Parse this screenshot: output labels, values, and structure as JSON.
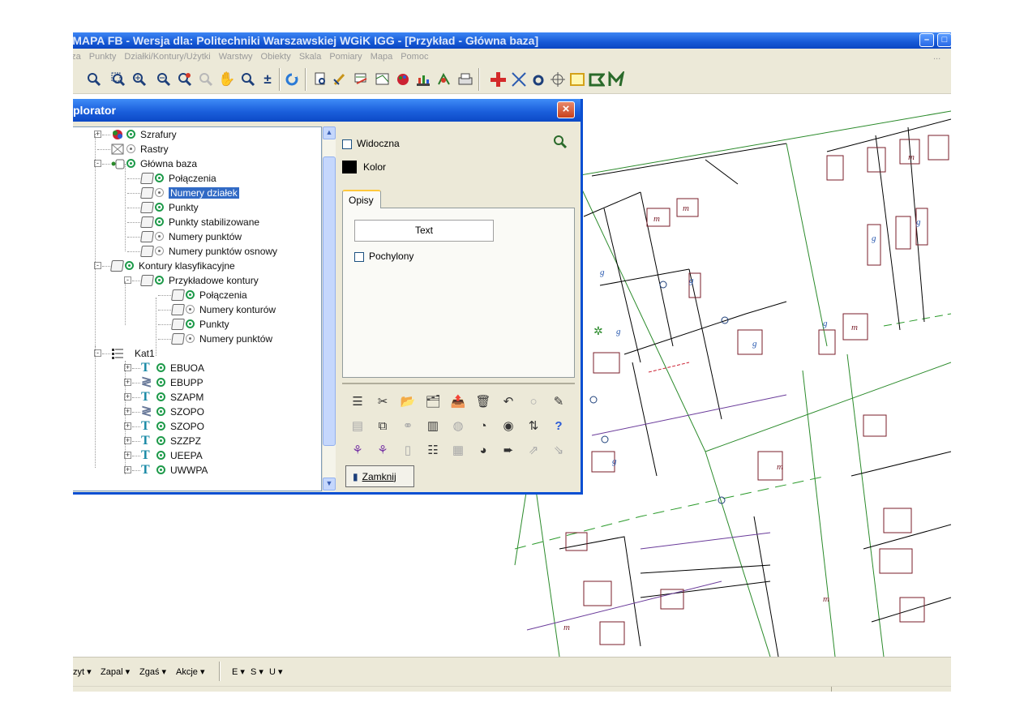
{
  "window": {
    "title": "WMAPA FB - Wersja dla: Politechniki Warszawskiej WGiK IGG - [Przykład - Główna baza]",
    "minimize": "–",
    "restore": "□"
  },
  "menu": [
    "aza",
    "Punkty",
    "Działki/Kontury/Użytki",
    "Warstwy",
    "Obiekty",
    "Skala",
    "Pomiary",
    "Mapa",
    "Pomoc"
  ],
  "menu_right": "...",
  "toolbar": {
    "icons": [
      "zoom-icon",
      "zoom-window-icon",
      "zoom-in-icon",
      "zoom-out-icon",
      "zoom-previous-icon",
      "zoom-disabled-icon",
      "pan-hand-icon",
      "zoom-all-icon",
      "zoom-plusminus-icon",
      "refresh-icon",
      "print-preview-icon",
      "edit-pen-icon",
      "layers-icon",
      "map-icon",
      "palette-icon",
      "chart-icon",
      "measure-icon",
      "print-icon",
      "add-cross-icon",
      "delete-x-icon",
      "point-circle-icon",
      "target-icon",
      "rectangle-icon",
      "polygon-icon",
      "polyline-icon"
    ]
  },
  "explorer": {
    "title": "plorator",
    "close": "×",
    "tree": [
      {
        "label": "Szrafury",
        "level": 0,
        "icon": "hatching-icon",
        "vis": "on",
        "expander": "+"
      },
      {
        "label": "Rastry",
        "level": 0,
        "icon": "raster-icon",
        "vis": "off",
        "expander": ""
      },
      {
        "label": "Główna baza",
        "level": 0,
        "icon": "database-icon",
        "vis": "on",
        "expander": "-"
      },
      {
        "label": "Połączenia",
        "level": 1,
        "icon": "layer-icon",
        "vis": "on",
        "expander": ""
      },
      {
        "label": "Numery działek",
        "level": 1,
        "icon": "layer-icon",
        "vis": "off",
        "expander": "",
        "selected": true
      },
      {
        "label": "Punkty",
        "level": 1,
        "icon": "layer-icon",
        "vis": "on",
        "expander": ""
      },
      {
        "label": "Punkty stabilizowane",
        "level": 1,
        "icon": "layer-icon",
        "vis": "on",
        "expander": ""
      },
      {
        "label": "Numery punktów",
        "level": 1,
        "icon": "layer-icon",
        "vis": "off",
        "expander": ""
      },
      {
        "label": "Numery punktów osnowy",
        "level": 1,
        "icon": "layer-icon",
        "vis": "off",
        "expander": ""
      },
      {
        "label": "Kontury klasyfikacyjne",
        "level": 0,
        "icon": "layer-icon",
        "vis": "on",
        "expander": "-"
      },
      {
        "label": "Przykładowe kontury",
        "level": 1,
        "icon": "layer-icon",
        "vis": "on",
        "expander": "-"
      },
      {
        "label": "Połączenia",
        "level": 2,
        "icon": "layer-icon",
        "vis": "on",
        "expander": ""
      },
      {
        "label": "Numery konturów",
        "level": 2,
        "icon": "layer-icon",
        "vis": "off",
        "expander": ""
      },
      {
        "label": "Punkty",
        "level": 2,
        "icon": "layer-icon",
        "vis": "on",
        "expander": ""
      },
      {
        "label": "Numery punktów",
        "level": 2,
        "icon": "layer-icon",
        "vis": "off",
        "expander": ""
      },
      {
        "label": "Kat1",
        "level": 0,
        "icon": "category-icon",
        "vis": "none",
        "expander": "-"
      },
      {
        "label": "EBUOA",
        "level": 1,
        "icon": "text-layer-icon",
        "vis": "on",
        "expander": "+"
      },
      {
        "label": "EBUPP",
        "level": 1,
        "icon": "symbol-layer-icon",
        "vis": "on",
        "expander": "+"
      },
      {
        "label": "SZAPM",
        "level": 1,
        "icon": "text-layer-icon",
        "vis": "on",
        "expander": "+"
      },
      {
        "label": "SZOPO",
        "level": 1,
        "icon": "symbol-layer-icon",
        "vis": "on",
        "expander": "+"
      },
      {
        "label": "SZOPO",
        "level": 1,
        "icon": "text-layer-icon",
        "vis": "on",
        "expander": "+"
      },
      {
        "label": "SZZPZ",
        "level": 1,
        "icon": "text-layer-icon",
        "vis": "on",
        "expander": "+"
      },
      {
        "label": "UEEPA",
        "level": 1,
        "icon": "text-layer-icon",
        "vis": "on",
        "expander": "+"
      },
      {
        "label": "UWWPA",
        "level": 1,
        "icon": "text-layer-icon",
        "vis": "on",
        "expander": "+"
      }
    ],
    "props": {
      "visible_label": "Widoczna",
      "visible_checked": false,
      "color_label": "Kolor",
      "color_value": "#000000",
      "tab_label": "Opisy",
      "text_button": "Text",
      "italic_label": "Pochylony",
      "italic_checked": false,
      "close_button": "Zamknij"
    },
    "action_icons": [
      "new-category-icon",
      "cut-icon",
      "open-folder-icon",
      "open-folder-multi-icon",
      "folder-export-icon",
      "trash-icon",
      "undo-icon",
      "circle-disabled-icon",
      "pen-icon",
      "calendar-disabled-icon",
      "copy-layer-icon",
      "link-disabled-icon",
      "book-icon",
      "stamp-disabled-icon",
      "pie-chart-icon",
      "eye-icon",
      "sort-az-icon",
      "help-icon",
      "tree-branch-icon",
      "tree-branch-2-icon",
      "trash-disabled-icon",
      "list-icon",
      "calculator-disabled-icon",
      "globe-icon",
      "forward-icon",
      "dxf-export-icon",
      "dxf-import-icon"
    ]
  },
  "bottombar": {
    "items": [
      "zyt ▾",
      "Zapal ▾",
      "Zgaś ▾",
      "Akcje ▾",
      "E ▾",
      "S ▾",
      "U ▾"
    ]
  },
  "map": {
    "parcel_number_label": "g",
    "building_label": "m",
    "colors": {
      "boundary": "#2a7a2a",
      "building": "#7a1e2a",
      "line": "#000000",
      "purple": "#6a3b9a",
      "dashed_green": "#3aa63a"
    }
  }
}
